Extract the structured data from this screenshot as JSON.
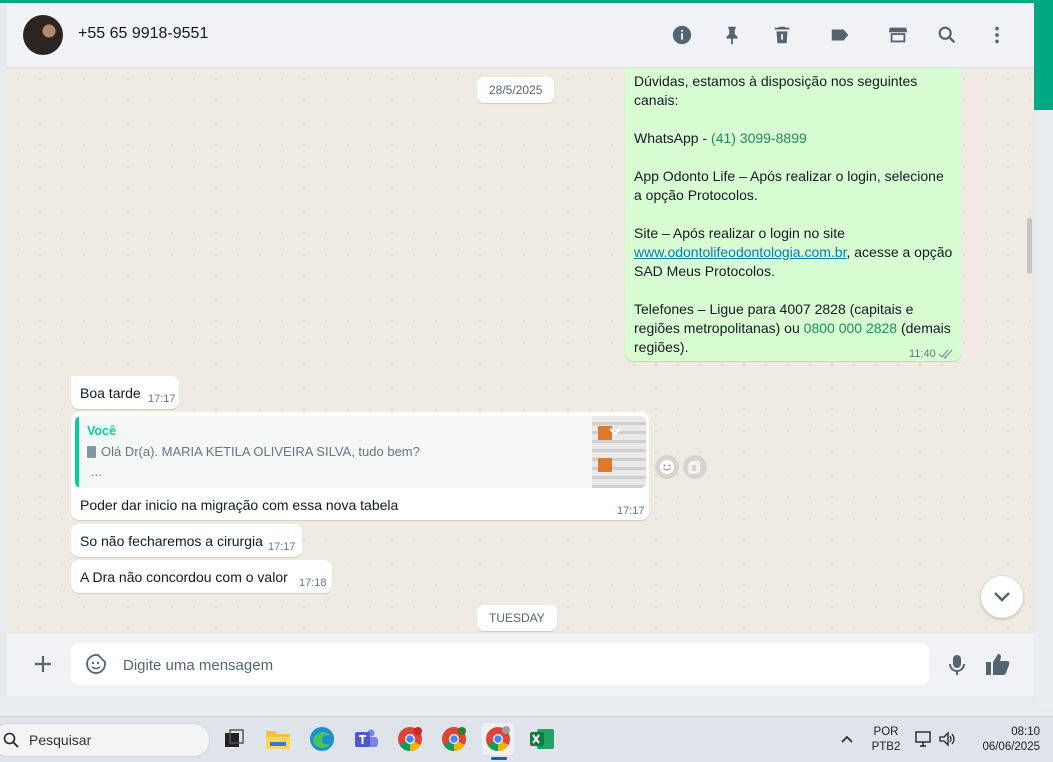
{
  "header": {
    "contact_name": "+55 65 9918-9551",
    "icons": [
      "info-icon",
      "pin-icon",
      "delete-icon",
      "label-icon",
      "catalog-icon",
      "search-icon",
      "menu-icon"
    ]
  },
  "chat": {
    "date_pill_1": "28/5/2025",
    "date_pill_2": "TUESDAY",
    "outgoing": {
      "line1": "Dúvidas, estamos à disposição nos seguintes",
      "line2": "canais:",
      "whatsapp_prefix": "WhatsApp - ",
      "whatsapp_number": "(41) 3099-8899",
      "app_text": "App Odonto Life – Após realizar o login, selecione a opção Protocolos.",
      "site_prefix": "Site – Após realizar o login no site ",
      "site_link": "www.odontolifeodontologia.com.br",
      "site_suffix": ", acesse a opção SAD Meus Protocolos.",
      "phones_prefix": "Telefones – Ligue para 4007 2828 (capitais e regiões metropolitanas) ou ",
      "phones_number": "0800 000 2828",
      "phones_suffix": " (demais regiões).",
      "time": "11:40"
    },
    "msg1": {
      "text": "Boa tarde",
      "time": "17:17"
    },
    "msg2": {
      "quote_author": "Você",
      "quote_text": "Olá Dr(a). MARIA KETILA OLIVEIRA SILVA, tudo bem?",
      "quote_more": "...",
      "text": "Poder dar inicio na migração com essa nova tabela",
      "time": "17:17"
    },
    "msg3": {
      "text": "So não fecharemos a cirurgia",
      "time": "17:17"
    },
    "msg4": {
      "text": "A Dra não concordou com o valor",
      "time": "17:18"
    }
  },
  "composer": {
    "placeholder": "Digite uma mensagem"
  },
  "taskbar": {
    "search_label": "Pesquisar",
    "lang_top": "POR",
    "lang_bottom": "PTB2",
    "clock_time": "08:10",
    "clock_date": "06/06/2025",
    "apps": [
      "task-view-icon",
      "file-explorer-icon",
      "edge-icon",
      "teams-icon",
      "chrome-icon",
      "chrome-icon",
      "chrome-icon",
      "excel-icon"
    ]
  },
  "colors": {
    "accent": "#00a884",
    "outgoing_bubble": "#d9fdd3",
    "quote_bar": "#06cf9c"
  }
}
